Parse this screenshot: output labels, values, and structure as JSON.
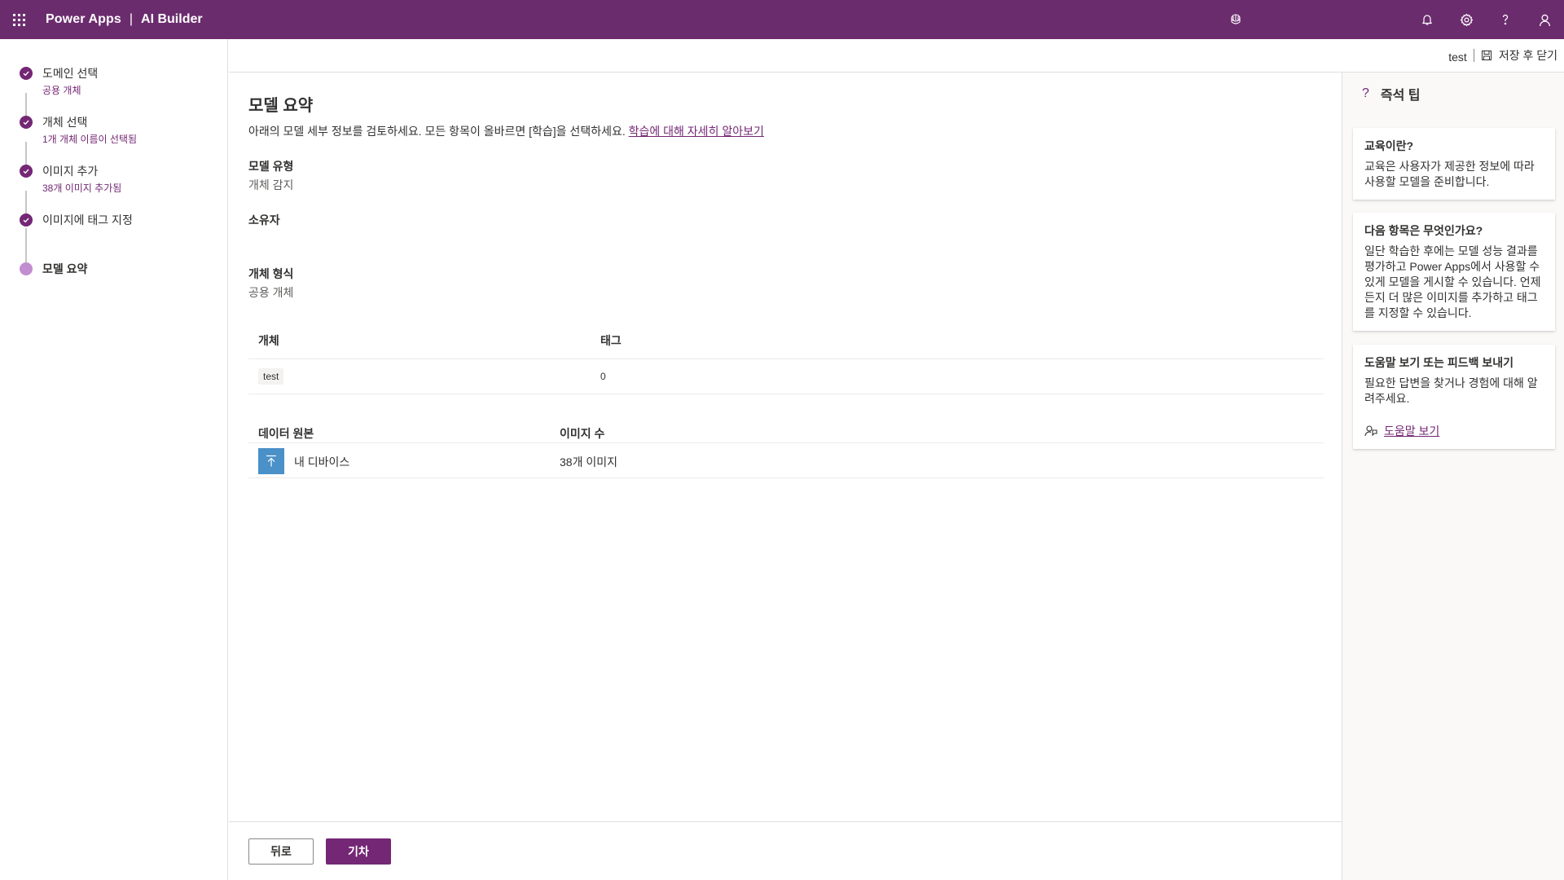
{
  "topbar": {
    "app_name": "Power Apps",
    "separator": "|",
    "product_name": "AI Builder",
    "brand_color": "#6b2c6e"
  },
  "steps": [
    {
      "label": "도메인 선택",
      "sub": "공용 개체",
      "state": "done"
    },
    {
      "label": "개체 선택",
      "sub": "1개 개체 이름이 선택됨",
      "state": "done"
    },
    {
      "label": "이미지 추가",
      "sub": "38개 이미지 추가됨",
      "state": "done"
    },
    {
      "label": "이미지에 태그 지정",
      "sub": "",
      "state": "done"
    },
    {
      "label": "모델 요약",
      "sub": "",
      "state": "current"
    }
  ],
  "commandbar": {
    "model_name": "test",
    "save_close_label": "저장 후 닫기"
  },
  "main": {
    "title": "모델 요약",
    "description": "아래의 모델 세부 정보를 검토하세요. 모든 항목이 올바르면 [학습]을 선택하세요.",
    "learn_more_link": "학습에 대해 자세히 알아보기",
    "model_type_label": "모델 유형",
    "model_type_value": "개체 감지",
    "owner_label": "소유자",
    "owner_value": "",
    "object_format_label": "개체 형식",
    "object_format_value": "공용 개체",
    "objects_table": {
      "headers": [
        "개체",
        "태그"
      ],
      "rows": [
        {
          "object": "test",
          "tags": "0"
        }
      ]
    },
    "sources_table": {
      "headers": [
        "데이터 원본",
        "이미지 수"
      ],
      "rows": [
        {
          "source": "내 디바이스",
          "count": "38개 이미지"
        }
      ]
    }
  },
  "footer": {
    "back_label": "뒤로",
    "train_label": "기차"
  },
  "tips": {
    "title": "즉석 팁",
    "cards": [
      {
        "title": "교육이란?",
        "body": "교육은 사용자가 제공한 정보에 따라 사용할 모델을 준비합니다."
      },
      {
        "title": "다음 항목은 무엇인가요?",
        "body": "일단 학습한 후에는 모델 성능 결과를 평가하고 Power Apps에서 사용할 수 있게 모델을 게시할 수 있습니다. 언제든지 더 많은 이미지를 추가하고 태그를 지정할 수 있습니다."
      },
      {
        "title": "도움말 보기 또는 피드백 보내기",
        "body": "필요한 답변을 찾거나 경험에 대해 알려주세요.",
        "link": "도움말 보기"
      }
    ]
  }
}
